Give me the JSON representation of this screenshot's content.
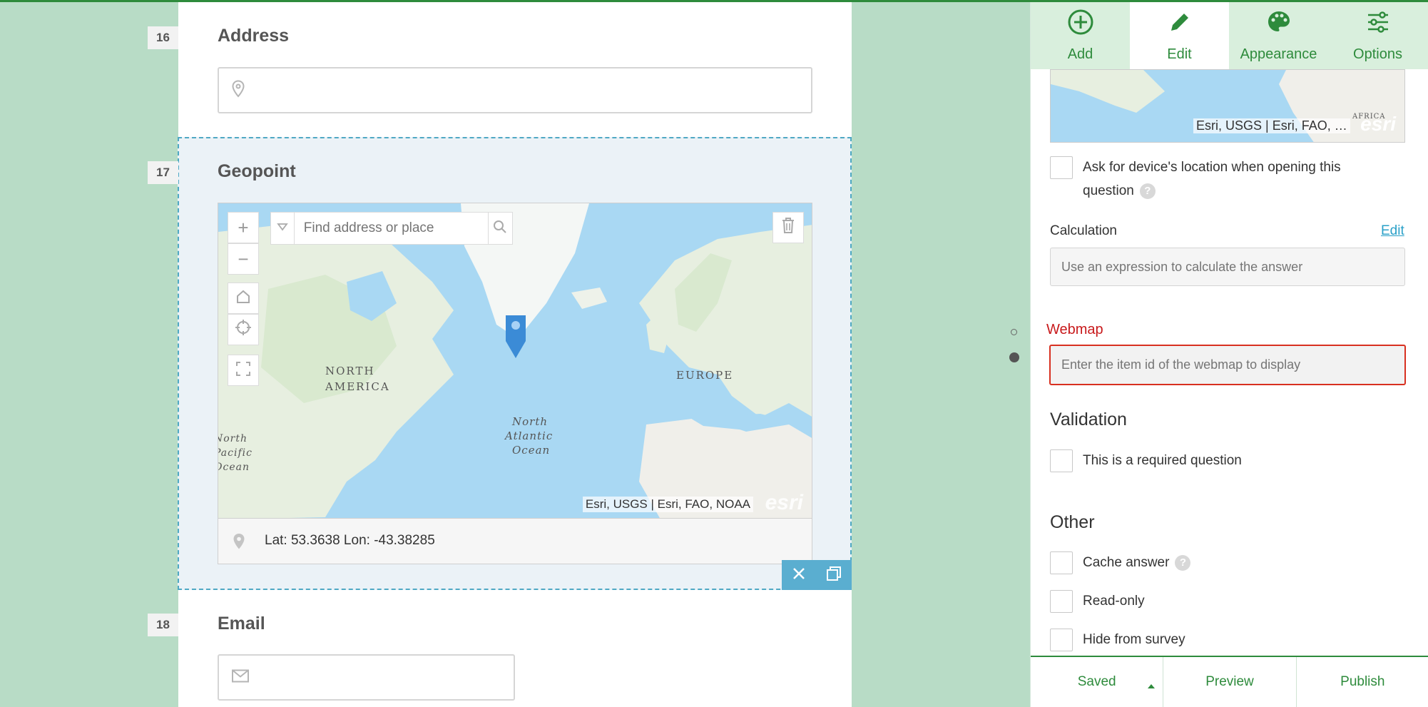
{
  "questions": [
    {
      "number": "16",
      "title": "Address",
      "field_icon": "map-pin-icon"
    },
    {
      "number": "17",
      "title": "Geopoint",
      "field_icon": "map-pin-icon"
    },
    {
      "number": "18",
      "title": "Email",
      "field_icon": "envelope-icon"
    }
  ],
  "geopoint": {
    "search_placeholder": "Find address or place",
    "attribution": "Esri, USGS | Esri, FAO, NOAA",
    "esri_logo": "esri",
    "latlon": "Lat: 53.3638 Lon: -43.38285",
    "map_labels": {
      "north_america_1": "NORTH",
      "north_america_2": "AMERICA",
      "europe": "EUROPE",
      "atlantic_1": "North",
      "atlantic_2": "Atlantic",
      "atlantic_3": "Ocean",
      "pacific_1": "North",
      "pacific_2": "Pacific",
      "pacific_3": "Ocean"
    }
  },
  "toolbar": {
    "add": "Add",
    "edit": "Edit",
    "appearance": "Appearance",
    "options": "Options"
  },
  "panel": {
    "minimap_attribution": "Esri, USGS | Esri, FAO, …",
    "minimap_label": "AFRICA",
    "ask_location": "Ask for device's location when opening this question",
    "calculation_label": "Calculation",
    "calculation_edit": "Edit",
    "calculation_placeholder": "Use an expression to calculate the answer",
    "webmap_label": "Webmap",
    "webmap_placeholder": "Enter the item id of the webmap to display",
    "validation_title": "Validation",
    "required_label": "This is a required question",
    "other_title": "Other",
    "cache_label": "Cache answer",
    "readonly_label": "Read-only",
    "hide_label": "Hide from survey"
  },
  "bottom": {
    "saved": "Saved",
    "preview": "Preview",
    "publish": "Publish"
  },
  "colors": {
    "brand_green": "#2e8b3c",
    "background": "#b8dcc6",
    "selection": "#4fa8c4",
    "error": "#c8191b"
  }
}
